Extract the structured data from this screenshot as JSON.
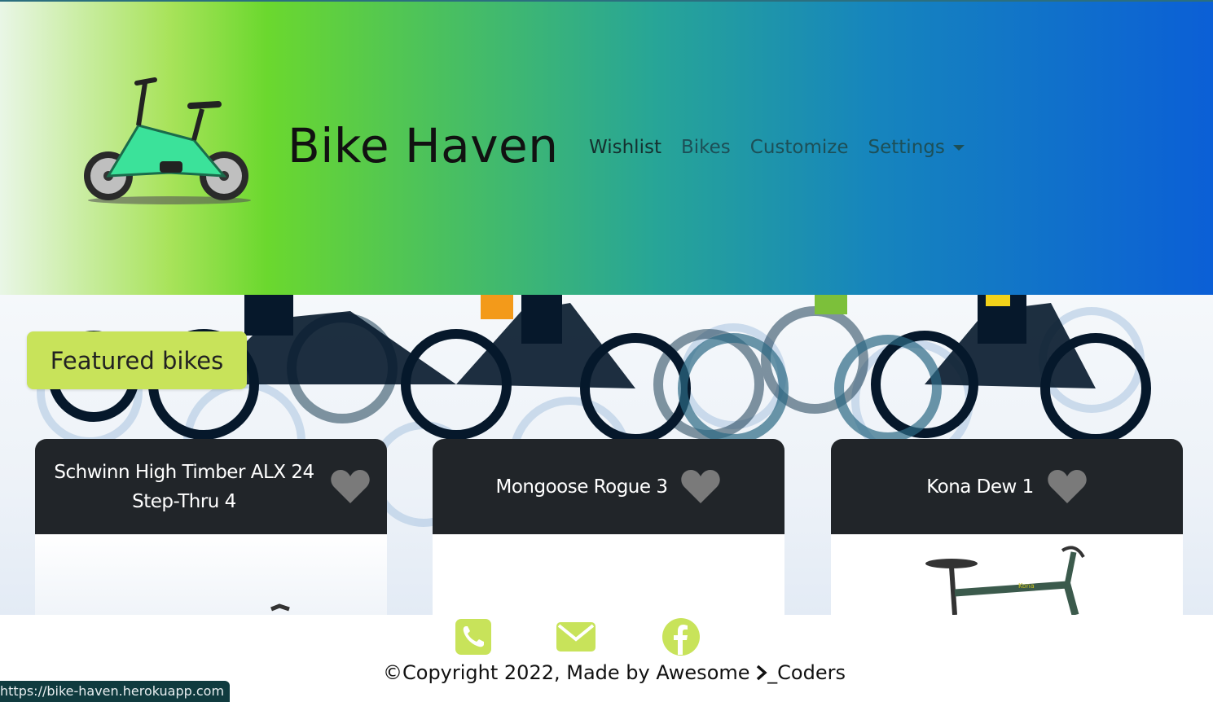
{
  "header": {
    "brand": "Bike Haven",
    "nav": [
      {
        "label": "Wishlist"
      },
      {
        "label": "Bikes"
      },
      {
        "label": "Customize"
      },
      {
        "label": "Settings"
      }
    ]
  },
  "hero": {
    "featured_label": "Featured bikes"
  },
  "cards": [
    {
      "title": "Schwinn High Timber ALX 24 Step-Thru 4",
      "icon": "heart-icon"
    },
    {
      "title": "Mongoose Rogue 3",
      "icon": "heart-icon"
    },
    {
      "title": "Kona Dew 1",
      "icon": "heart-icon"
    }
  ],
  "footer": {
    "icons": [
      "phone-icon",
      "envelope-icon",
      "facebook-icon"
    ],
    "copyright_prefix": "©Copyright 2022, Made by Awesome ",
    "copyright_suffix": "_Coders"
  },
  "status_bar": {
    "url": "https://bike-haven.herokuapp.com"
  },
  "colors": {
    "accent": "#c8e35a",
    "card_header": "#212529",
    "gradient_start": "#e9f6e6",
    "gradient_mid": "#6bd82e",
    "gradient_end": "#0b5fd6"
  }
}
